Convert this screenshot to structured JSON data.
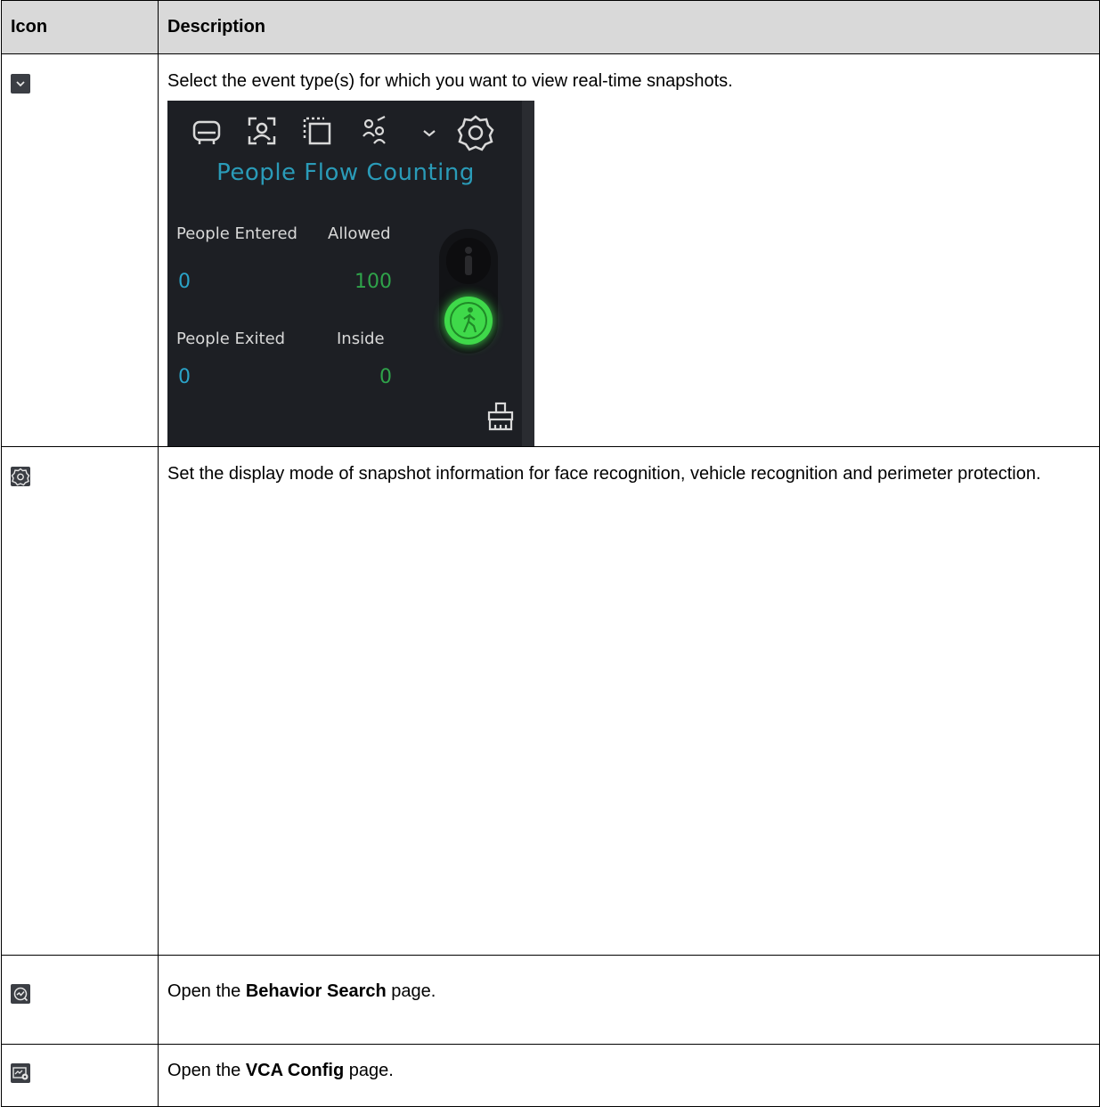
{
  "table": {
    "headers": {
      "icon": "Icon",
      "description": "Description"
    },
    "rows": [
      {
        "icon": "chevron-down-icon",
        "description": "Select the event type(s) for which you want to view real-time snapshots."
      },
      {
        "icon": "gear-icon",
        "description": "Set the display mode of snapshot information for face recognition, vehicle recognition and perimeter protection."
      },
      {
        "icon": "behavior-search-icon",
        "description_pre": "Open the ",
        "description_bold": "Behavior Search",
        "description_post": " page."
      },
      {
        "icon": "vca-config-icon",
        "description_pre": "Open the ",
        "description_bold": "VCA Config",
        "description_post": " page."
      }
    ]
  },
  "snapshot": {
    "title": "People Flow Counting",
    "people_entered_label": "People Entered",
    "allowed_label": "Allowed",
    "people_entered_value": "0",
    "allowed_value": "100",
    "people_exited_label": "People Exited",
    "inside_label": "Inside",
    "people_exited_value": "0",
    "inside_value": "0",
    "colors": {
      "title": "#2a9bb8",
      "value_cyan": "#2aa3c8",
      "value_green": "#2fa34a",
      "light_green": "#3fd94a"
    }
  }
}
